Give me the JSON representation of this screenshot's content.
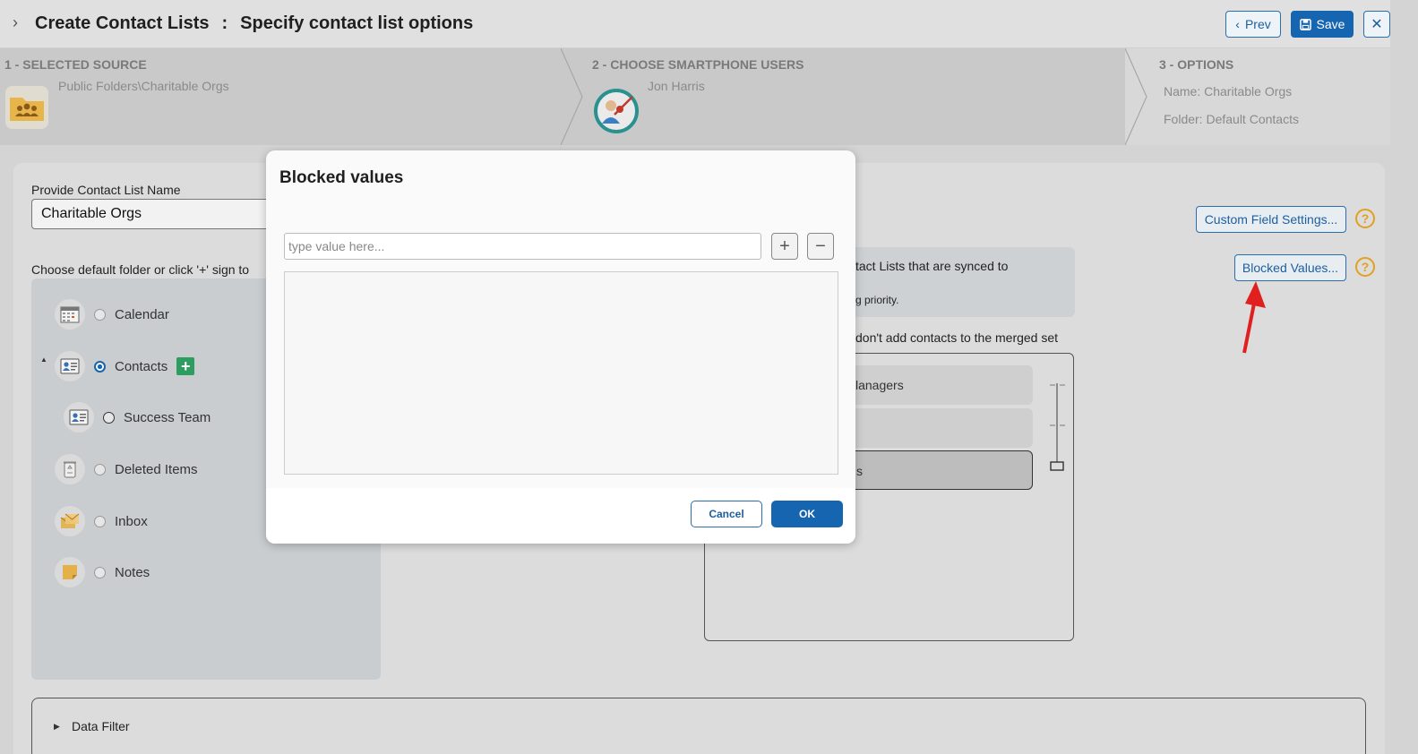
{
  "header": {
    "title": "Create Contact Lists",
    "separator": ":",
    "subtitle": "Specify contact list options",
    "prev_label": "Prev",
    "save_label": "Save"
  },
  "steps": [
    {
      "label": "1 - SELECTED SOURCE",
      "lines": [
        "Public Folders\\Charitable Orgs"
      ]
    },
    {
      "label": "2 - CHOOSE SMARTPHONE USERS",
      "lines": [
        "Jon Harris"
      ]
    },
    {
      "label": "3 - OPTIONS",
      "lines": [
        "Name: Charitable Orgs",
        "Folder: Default Contacts"
      ]
    }
  ],
  "form": {
    "name_label": "Provide Contact List Name",
    "name_value": "Charitable Orgs",
    "folder_label": "Choose default folder or click '+' sign to"
  },
  "folders": [
    {
      "label": "Calendar",
      "icon": "calendar-icon"
    },
    {
      "label": "Contacts",
      "icon": "contact-card-icon",
      "selected": true
    },
    {
      "label": "Success Team",
      "icon": "contact-card-icon"
    },
    {
      "label": "Deleted Items",
      "icon": "trash-icon"
    },
    {
      "label": "Inbox",
      "icon": "inbox-icon"
    },
    {
      "label": "Notes",
      "icon": "note-icon"
    }
  ],
  "right": {
    "custom_fields_label": "Custom Field Settings...",
    "blocked_values_label": "Blocked Values...",
    "help_glyph": "?",
    "info_text_1": "tact Lists that are synced to",
    "info_text_2": "g priority.",
    "merge_text": "don't add contacts to the merged set",
    "merge_items": [
      "lanagers",
      "",
      "s"
    ]
  },
  "data_filter_label": "Data Filter",
  "modal": {
    "title": "Blocked values",
    "input_placeholder": "type value here...",
    "input_value": "",
    "add_glyph": "+",
    "remove_glyph": "−",
    "cancel_label": "Cancel",
    "ok_label": "OK"
  },
  "colors": {
    "accent": "#1565b0",
    "help": "#e3a020",
    "add_green": "#2e9e60",
    "annotation_arrow": "#e0201e"
  }
}
